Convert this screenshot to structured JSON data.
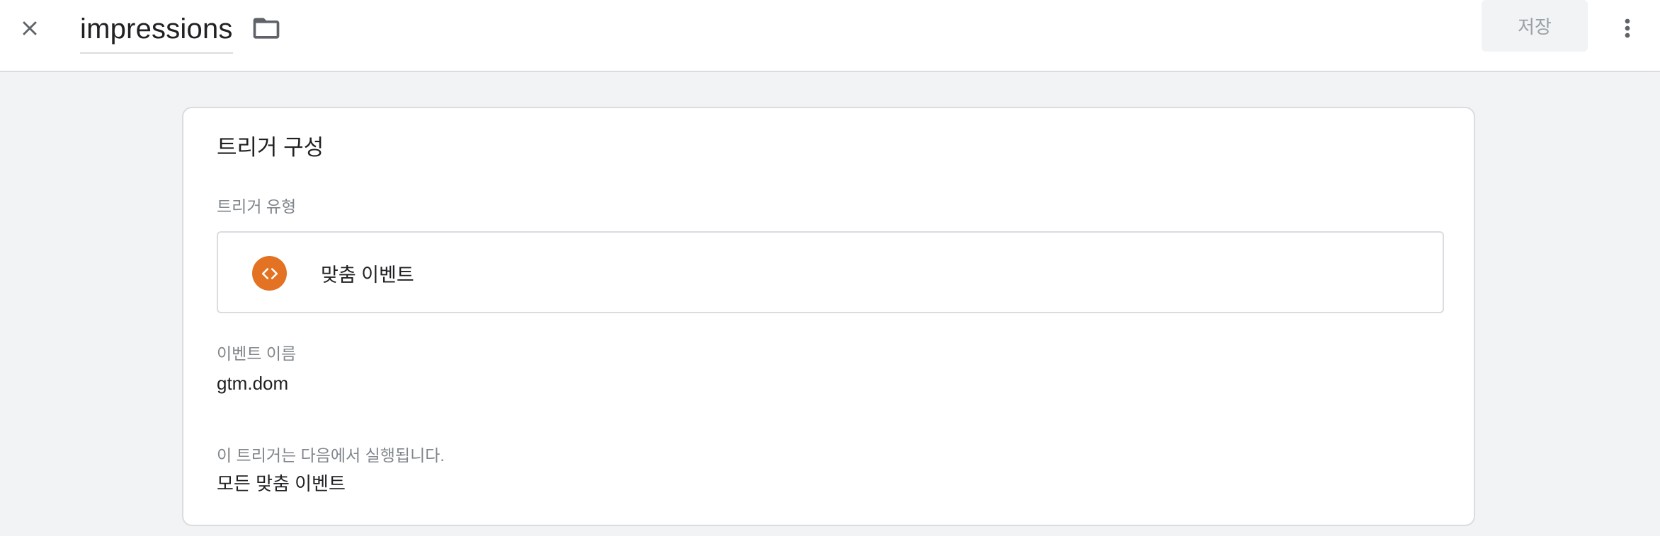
{
  "header": {
    "title": "impressions",
    "save_label": "저장",
    "close_icon": "close-icon",
    "folder_icon": "folder-icon",
    "more_icon": "more-vert-icon"
  },
  "card": {
    "title": "트리거 구성",
    "trigger_type_label": "트리거 유형",
    "trigger_type": {
      "name": "맞춤 이벤트",
      "icon": "code-icon",
      "icon_color": "#e37222"
    },
    "event_name_label": "이벤트 이름",
    "event_name": "gtm.dom",
    "fires_on_label": "이 트리거는 다음에서 실행됩니다.",
    "fires_on": "모든 맞춤 이벤트"
  }
}
